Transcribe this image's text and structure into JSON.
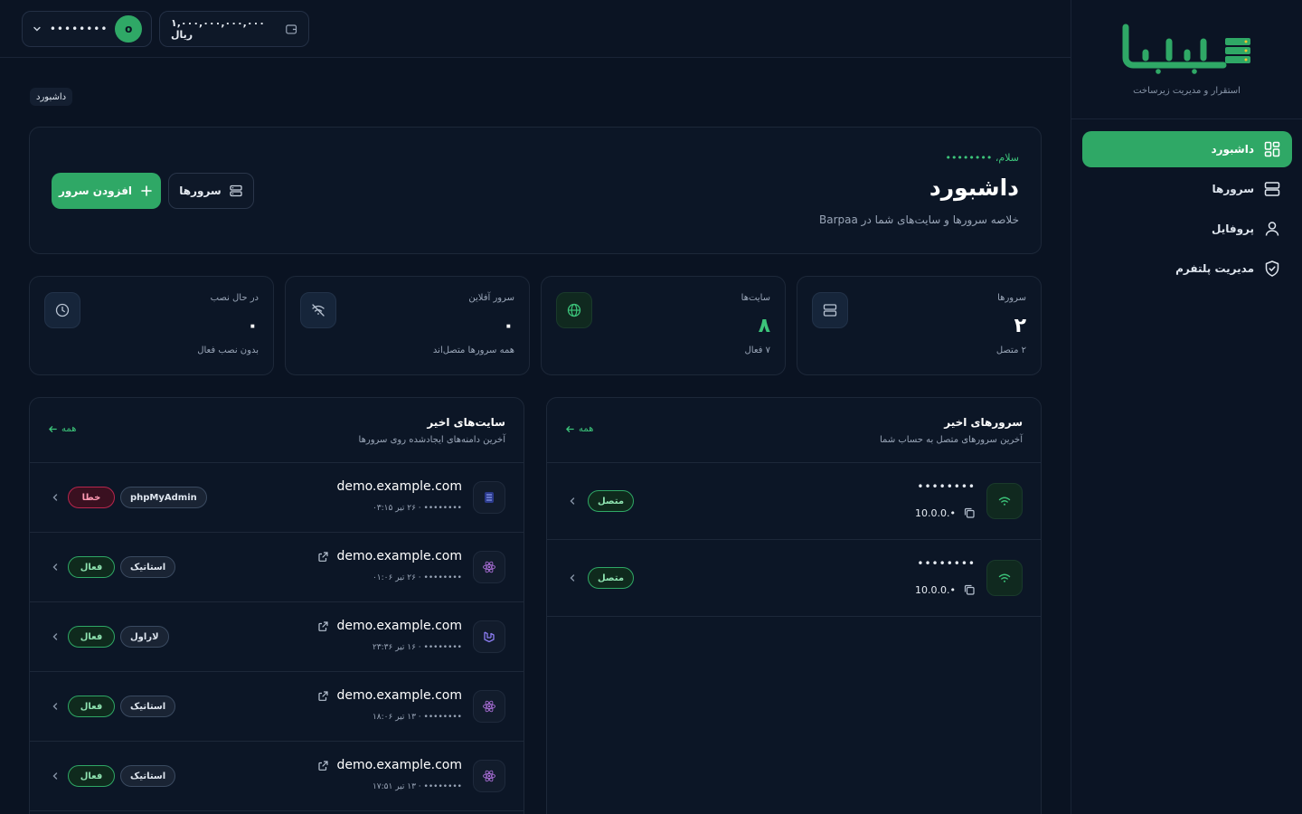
{
  "brand": {
    "logo_text": "بربپا",
    "tagline": "استقرار و مدیریت زیرساخت"
  },
  "sidebar": {
    "items": [
      {
        "label": "داشبورد",
        "icon": "dashboard-icon",
        "active": true
      },
      {
        "label": "سرورها",
        "icon": "server-icon",
        "active": false
      },
      {
        "label": "پروفایل",
        "icon": "user-icon",
        "active": false
      },
      {
        "label": "مدیریت پلتفرم",
        "icon": "shield-icon",
        "active": false
      }
    ]
  },
  "topbar": {
    "username": "••••••••",
    "avatar_initial": "o",
    "balance": "۱,۰۰۰,۰۰۰,۰۰۰,۰۰۰ ریال"
  },
  "breadcrumb": "داشبورد",
  "hero": {
    "greeting": "سلام، ••••••••",
    "title": "داشبورد",
    "subtitle": "خلاصه سرورها و سایت‌های شما در Barpaa",
    "add_button": "افزودن سرور",
    "servers_button": "سرورها"
  },
  "stats": [
    {
      "label": "سرورها",
      "value": "۲",
      "sub": "۲ متصل",
      "icon": "server-icon",
      "accent": false
    },
    {
      "label": "سایت‌ها",
      "value": "۸",
      "sub": "۷ فعال",
      "icon": "globe-icon",
      "accent": true
    },
    {
      "label": "سرور آفلاین",
      "value": "۰",
      "sub": "همه سرورها متصل‌اند",
      "icon": "wifi-off-icon",
      "accent": false
    },
    {
      "label": "در حال نصب",
      "value": "۰",
      "sub": "بدون نصب فعال",
      "icon": "clock-icon",
      "accent": false
    }
  ],
  "recent_servers": {
    "title": "سرورهای اخیر",
    "subtitle": "آخرین سرورهای متصل به حساب شما",
    "all_label": "همه",
    "rows": [
      {
        "name": "••••••••",
        "ip": "10.0.0.•",
        "status": "متصل"
      },
      {
        "name": "••••••••",
        "ip": "10.0.0.•",
        "status": "متصل"
      }
    ]
  },
  "recent_sites": {
    "title": "سایت‌های اخیر",
    "subtitle": "آخرین دامنه‌های ایجادشده روی سرورها",
    "all_label": "همه",
    "rows": [
      {
        "domain": "demo.example.com",
        "meta": "•••••••• · ۲۶ تیر ۰۳:۱۵",
        "type": "phpMyAdmin",
        "status": "خطا",
        "status_kind": "error",
        "icon": "database-icon",
        "external": false
      },
      {
        "domain": "demo.example.com",
        "meta": "•••••••• · ۲۶ تیر ۰۱:۰۶",
        "type": "استاتیک",
        "status": "فعال",
        "status_kind": "ok",
        "icon": "react-icon",
        "external": true
      },
      {
        "domain": "demo.example.com",
        "meta": "•••••••• · ۱۶ تیر ۲۳:۳۶",
        "type": "لاراول",
        "status": "فعال",
        "status_kind": "ok",
        "icon": "laravel-icon",
        "external": true
      },
      {
        "domain": "demo.example.com",
        "meta": "•••••••• · ۱۳ تیر ۱۸:۰۶",
        "type": "استاتیک",
        "status": "فعال",
        "status_kind": "ok",
        "icon": "react-icon",
        "external": true
      },
      {
        "domain": "demo.example.com",
        "meta": "•••••••• · ۱۳ تیر ۱۷:۵۱",
        "type": "استاتیک",
        "status": "فعال",
        "status_kind": "ok",
        "icon": "react-icon",
        "external": true
      }
    ]
  },
  "colors": {
    "accent": "#2fa866",
    "background": "#0a1322",
    "error": "#b8264d"
  }
}
